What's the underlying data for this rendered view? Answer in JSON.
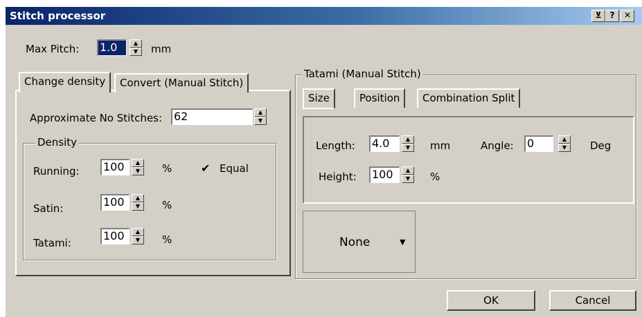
{
  "window": {
    "title": "Stitch processor"
  },
  "title_buttons": [
    "pin-icon",
    "help-icon",
    "close-icon"
  ],
  "max_pitch": {
    "label": "Max Pitch:",
    "value": "1.0",
    "unit": "mm"
  },
  "left_tabs": [
    "Change density",
    "Convert (Manual Stitch)"
  ],
  "approx": {
    "label": "Approximate No Stitches:",
    "value": "62"
  },
  "density": {
    "legend": "Density",
    "running": {
      "label": "Running:",
      "value": "100",
      "unit": "%"
    },
    "satin": {
      "label": "Satin:",
      "value": "100",
      "unit": "%"
    },
    "tatami": {
      "label": "Tatami:",
      "value": "100",
      "unit": "%"
    },
    "equal": {
      "label": "Equal",
      "checked": true
    }
  },
  "tatami_group": {
    "legend": "Tatami (Manual Stitch)",
    "tabs": [
      "Size",
      "Position",
      "Combination Split"
    ],
    "length": {
      "label": "Length:",
      "value": "4.0",
      "unit": "mm"
    },
    "angle": {
      "label": "Angle:",
      "value": "0",
      "unit": "Deg"
    },
    "height": {
      "label": "Height:",
      "value": "100",
      "unit": "%"
    },
    "combo": {
      "value": "None"
    }
  },
  "buttons": {
    "ok": "OK",
    "cancel": "Cancel"
  }
}
